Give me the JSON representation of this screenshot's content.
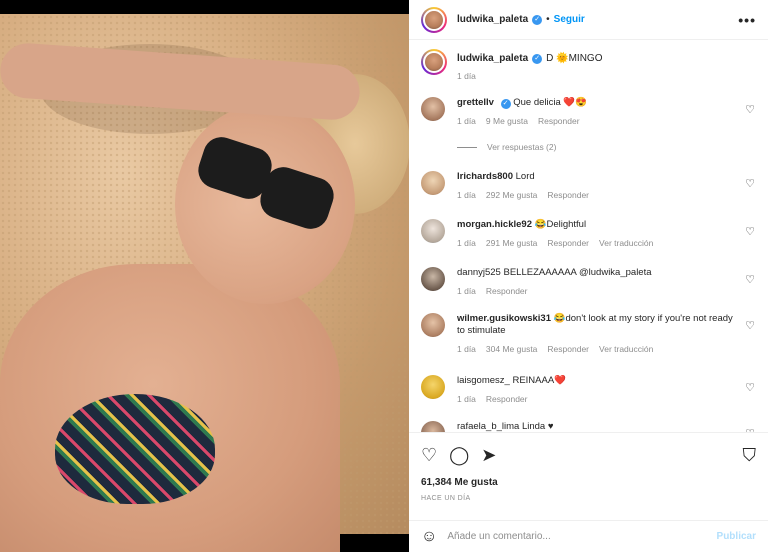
{
  "post": {
    "image_alt": "Beach selfie",
    "author": "ludwika_paleta",
    "follow_label": "Seguir",
    "more_label": "•••",
    "caption": {
      "author": "ludwika_paleta",
      "text": "D 🌞MINGO",
      "time": "1 día"
    },
    "comments": [
      {
        "user": "grettellv",
        "verified": true,
        "text": "Que delicia ❤️😍",
        "time": "1 día",
        "likes": "9 Me gusta",
        "reply": "Responder",
        "translate": "",
        "replies": "Ver respuestas (2)"
      },
      {
        "user": "lrichards800",
        "verified": false,
        "text": "Lord",
        "time": "1 día",
        "likes": "292 Me gusta",
        "reply": "Responder",
        "translate": "",
        "replies": ""
      },
      {
        "user": "morgan.hickle92",
        "verified": false,
        "text": "😂Delightful",
        "time": "1 día",
        "likes": "291 Me gusta",
        "reply": "Responder",
        "translate": "Ver traducción",
        "replies": ""
      },
      {
        "user": "dannyj525",
        "verified": false,
        "text": "BELLEZAAAAAA @ludwika_paleta",
        "time": "1 día",
        "likes": "",
        "reply": "Responder",
        "translate": "",
        "replies": ""
      },
      {
        "user": "wilmer.gusikowski31",
        "verified": false,
        "text": "😂don't look at my story if you're not ready to stimulate",
        "time": "1 día",
        "likes": "304 Me gusta",
        "reply": "Responder",
        "translate": "Ver traducción",
        "replies": ""
      },
      {
        "user": "laisgomesz_",
        "verified": false,
        "text": "REINAAA❤️",
        "time": "1 día",
        "likes": "",
        "reply": "Responder",
        "translate": "",
        "replies": ""
      },
      {
        "user": "rafaela_b_lima",
        "verified": false,
        "text": "Linda ♥",
        "time": "",
        "likes": "",
        "reply": "",
        "translate": "",
        "replies": ""
      }
    ],
    "likes_total": "61,384 Me gusta",
    "posted_ago": "HACE UN DÍA",
    "comment_placeholder": "Añade un comentario...",
    "publish_label": "Publicar"
  },
  "icons": {
    "heart": "♡",
    "comment": "◯",
    "share": "➤",
    "bookmark": "⛉",
    "emoji": "☺"
  },
  "colors": {
    "accent": "#0095f6",
    "text": "#262626",
    "muted": "#8e8e8e",
    "verified": "#3897f0"
  }
}
